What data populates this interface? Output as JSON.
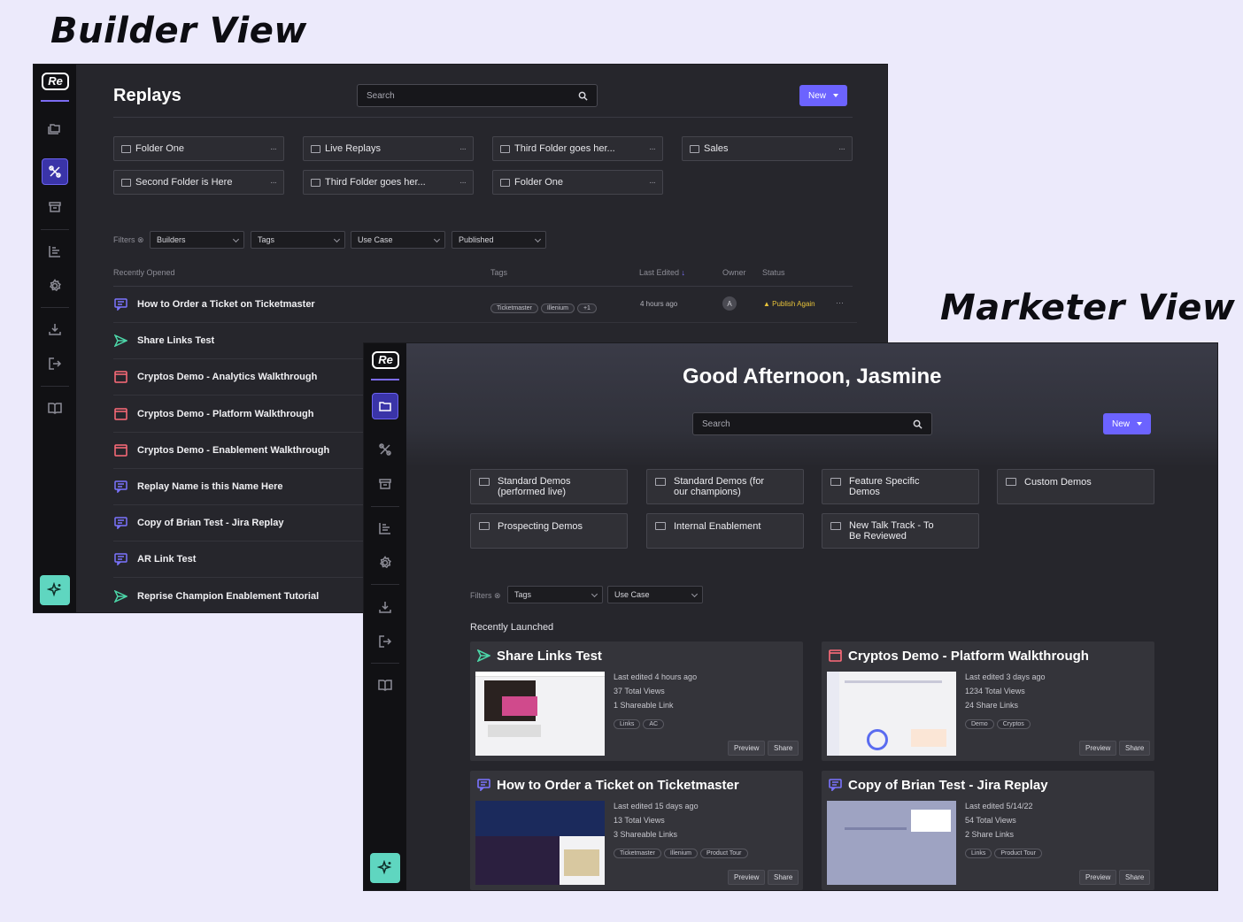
{
  "headings": {
    "builder": "Builder View",
    "marketer": "Marketer View"
  },
  "logo": "Re",
  "builder": {
    "title": "Replays",
    "search_placeholder": "Search",
    "new_label": "New",
    "folders": [
      "Folder One",
      "Live Replays",
      "Third Folder goes her...",
      "Sales",
      "Second Folder is Here",
      "Third Folder goes her...",
      "Folder One"
    ],
    "folder_menu": "···",
    "filters_label": "Filters",
    "filters": [
      "Builders",
      "Tags",
      "Use Case",
      "Published"
    ],
    "columns": {
      "recently_opened": "Recently Opened",
      "tags": "Tags",
      "last_edited": "Last Edited",
      "owner": "Owner",
      "status": "Status"
    },
    "first_row": {
      "tags": [
        "Ticketmaster",
        "Illenium",
        "+1"
      ],
      "last_edited": "4 hours ago",
      "owner_initial": "A",
      "status": "Publish Again",
      "menu": "···"
    },
    "rows": [
      {
        "name": "How to Order a Ticket on Ticketmaster",
        "icon": "chat-icon",
        "color": "#7b74ff"
      },
      {
        "name": "Share Links Test",
        "icon": "send-icon",
        "color": "#4cd6a8"
      },
      {
        "name": "Cryptos Demo - Analytics Walkthrough",
        "icon": "browser-icon",
        "color": "#ff6b7a"
      },
      {
        "name": "Cryptos Demo - Platform Walkthrough",
        "icon": "browser-icon",
        "color": "#ff6b7a"
      },
      {
        "name": "Cryptos Demo - Enablement Walkthrough",
        "icon": "browser-icon",
        "color": "#ff6b7a"
      },
      {
        "name": "Replay Name is this Name Here",
        "icon": "chat-icon",
        "color": "#7b74ff"
      },
      {
        "name": "Copy of Brian Test - Jira Replay",
        "icon": "chat-icon",
        "color": "#7b74ff"
      },
      {
        "name": "AR Link Test",
        "icon": "chat-icon",
        "color": "#7b74ff"
      },
      {
        "name": "Reprise Champion Enablement Tutorial",
        "icon": "send-icon",
        "color": "#4cd6a8"
      }
    ]
  },
  "marketer": {
    "greeting": "Good Afternoon, Jasmine",
    "search_placeholder": "Search",
    "new_label": "New",
    "folders": [
      [
        "Standard Demos",
        "(performed live)"
      ],
      [
        "Standard Demos (for",
        "our champions)"
      ],
      [
        "Feature Specific",
        "Demos"
      ],
      [
        "Custom Demos",
        ""
      ],
      [
        "Prospecting Demos",
        ""
      ],
      [
        "Internal Enablement",
        ""
      ],
      [
        "New Talk Track - To",
        "Be Reviewed"
      ]
    ],
    "filters_label": "Filters",
    "filters": [
      "Tags",
      "Use Case"
    ],
    "section_label": "Recently Launched",
    "preview_label": "Preview",
    "share_label": "Share",
    "cards": [
      {
        "title": "Share Links Test",
        "icon": "send-icon",
        "color": "#4cd6a8",
        "edited": "Last edited 4 hours ago",
        "views": "37 Total Views",
        "links": "1 Shareable Link",
        "tags": [
          "Links",
          "AC"
        ]
      },
      {
        "title": "Cryptos Demo - Platform Walkthrough",
        "icon": "browser-icon",
        "color": "#ff6b7a",
        "edited": "Last edited 3 days ago",
        "views": "1234 Total Views",
        "links": "24 Share Links",
        "tags": [
          "Demo",
          "Cryptos"
        ]
      },
      {
        "title": "How to Order a Ticket on Ticketmaster",
        "icon": "chat-icon",
        "color": "#7b74ff",
        "edited": "Last edited 15 days ago",
        "views": "13 Total Views",
        "links": "3 Shareable Links",
        "tags": [
          "Ticketmaster",
          "Illenium",
          "Product Tour"
        ]
      },
      {
        "title": "Copy of Brian Test - Jira Replay",
        "icon": "chat-icon",
        "color": "#7b74ff",
        "edited": "Last edited 5/14/22",
        "views": "54 Total Views",
        "links": "2 Share Links",
        "tags": [
          "Links",
          "Product Tour"
        ]
      }
    ]
  }
}
